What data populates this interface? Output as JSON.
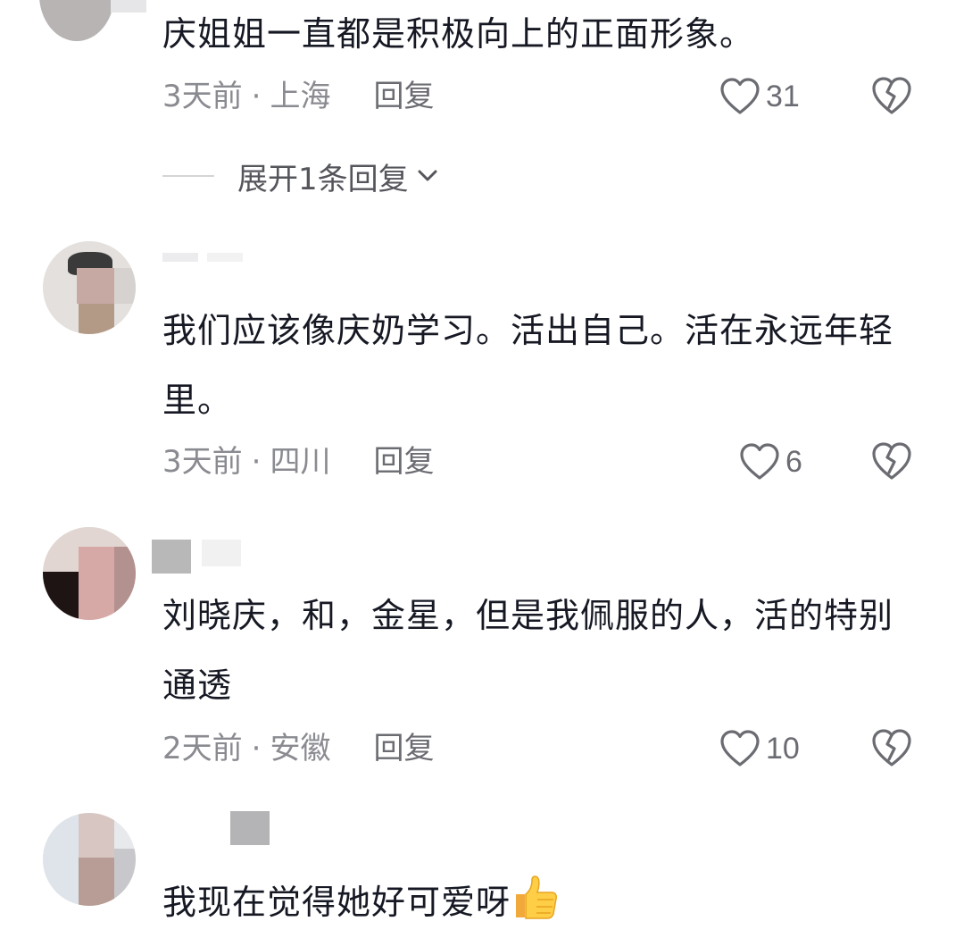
{
  "comments": [
    {
      "text": "庆姐姐一直都是积极向上的正面形象。",
      "time": "3天前",
      "location": "上海",
      "reply_label": "回复",
      "likes": "31",
      "expand_label": "展开1条回复"
    },
    {
      "text": "我们应该像庆奶学习。活出自己。活在永远年轻里。",
      "time": "3天前",
      "location": "四川",
      "reply_label": "回复",
      "likes": "6"
    },
    {
      "text": "刘晓庆，和，金星，但是我佩服的人，活的特别通透",
      "time": "2天前",
      "location": "安徽",
      "reply_label": "回复",
      "likes": "10"
    },
    {
      "text": "我现在觉得她好可爱呀",
      "emoji": "thumbs-up-emoji"
    }
  ],
  "separator": "·",
  "icons": {
    "like": "heart-outline-icon",
    "dislike": "broken-heart-icon",
    "expand": "chevron-down-icon"
  },
  "colors": {
    "text": "#161823",
    "meta": "#8a8b91",
    "icon": "#6b6c72"
  }
}
